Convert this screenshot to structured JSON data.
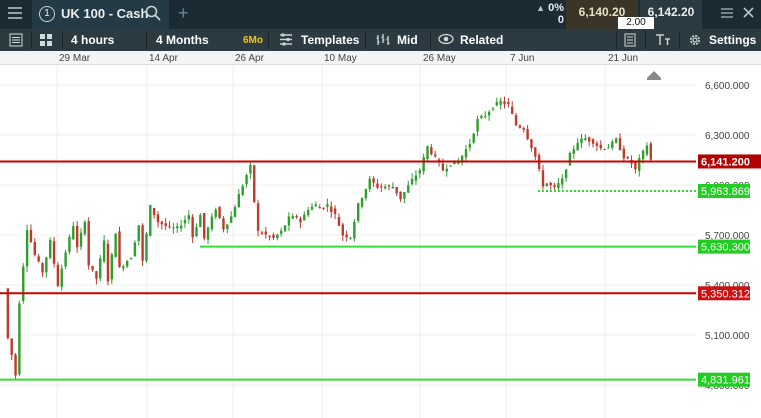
{
  "header": {
    "tab_number": "1",
    "instrument": "UK 100 - Cash",
    "change_pct": "0%",
    "change_value": "0",
    "sell_price": "6,140.20",
    "buy_price": "6,142.20",
    "spread": "2.00"
  },
  "toolbar": {
    "interval": "4 hours",
    "range": "4 Months",
    "range_preset": "6Mo",
    "templates": "Templates",
    "price_type": "Mid",
    "related": "Related",
    "settings": "Settings"
  },
  "icons": [
    "hamburger-icon",
    "search-icon",
    "plus-icon",
    "list-icon",
    "grid-icon",
    "templates-icon",
    "bar-chart-icon",
    "eye-icon",
    "doc-icon",
    "text-size-icon",
    "gear-icon",
    "detach-icon",
    "close-icon"
  ],
  "colors": {
    "up": "#2e9e2e",
    "down": "#c0392b",
    "support": "#33dd33",
    "resistance": "#cc0000"
  },
  "chart_data": {
    "type": "candlestick",
    "x_ticks": [
      "29 Mar",
      "14 Apr",
      "26 Apr",
      "10 May",
      "26 May",
      "7 Jun",
      "21 Jun"
    ],
    "y_ticks": [
      "6,600.000",
      "6,300.000",
      "6,000.000",
      "5,700.000",
      "5,400.000",
      "5,100.000",
      "4,800.000"
    ],
    "ylim": [
      4760,
      6700
    ],
    "lines": [
      {
        "label": "6,141.200",
        "value": 6141.2,
        "style": "solid",
        "color": "#cc0000"
      },
      {
        "label": "5,963.869",
        "value": 5963.869,
        "style": "dotted",
        "color": "#33dd33"
      },
      {
        "label": "5,630.300",
        "value": 5630.3,
        "style": "solid",
        "color": "#33dd33"
      },
      {
        "label": "5,350.312",
        "value": 5350.312,
        "style": "solid",
        "color": "#cc0000"
      },
      {
        "label": "4,831.961",
        "value": 4831.961,
        "style": "solid",
        "color": "#33dd33"
      }
    ],
    "series_path": [
      [
        0,
        5380
      ],
      [
        1,
        5080
      ],
      [
        2,
        4980
      ],
      [
        3,
        4860
      ],
      [
        4,
        5300
      ],
      [
        5,
        5520
      ],
      [
        6,
        5740
      ],
      [
        8,
        5580
      ],
      [
        10,
        5480
      ],
      [
        12,
        5660
      ],
      [
        14,
        5400
      ],
      [
        16,
        5600
      ],
      [
        18,
        5760
      ],
      [
        19,
        5620
      ],
      [
        21,
        5790
      ],
      [
        22,
        5520
      ],
      [
        24,
        5440
      ],
      [
        26,
        5660
      ],
      [
        27,
        5430
      ],
      [
        29,
        5720
      ],
      [
        30,
        5500
      ],
      [
        33,
        5570
      ],
      [
        35,
        5760
      ],
      [
        36,
        5540
      ],
      [
        38,
        5870
      ],
      [
        40,
        5780
      ],
      [
        43,
        5740
      ],
      [
        45,
        5740
      ],
      [
        48,
        5820
      ],
      [
        49,
        5690
      ],
      [
        51,
        5820
      ],
      [
        52,
        5680
      ],
      [
        55,
        5860
      ],
      [
        57,
        5740
      ],
      [
        59,
        5810
      ],
      [
        61,
        5940
      ],
      [
        63,
        6060
      ],
      [
        64,
        6110
      ],
      [
        65,
        5900
      ],
      [
        66,
        5720
      ],
      [
        68,
        5700
      ],
      [
        70,
        5680
      ],
      [
        72,
        5720
      ],
      [
        74,
        5800
      ],
      [
        76,
        5810
      ],
      [
        77,
        5780
      ],
      [
        79,
        5860
      ],
      [
        81,
        5880
      ],
      [
        82,
        5860
      ],
      [
        84,
        5880
      ],
      [
        86,
        5820
      ],
      [
        88,
        5700
      ],
      [
        90,
        5690
      ],
      [
        92,
        5880
      ],
      [
        95,
        6030
      ],
      [
        97,
        5990
      ],
      [
        99,
        5990
      ],
      [
        101,
        5990
      ],
      [
        103,
        5920
      ],
      [
        106,
        6030
      ],
      [
        108,
        6090
      ],
      [
        110,
        6230
      ],
      [
        112,
        6160
      ],
      [
        114,
        6090
      ],
      [
        116,
        6130
      ],
      [
        118,
        6140
      ],
      [
        121,
        6250
      ],
      [
        123,
        6390
      ],
      [
        125,
        6420
      ],
      [
        127,
        6470
      ],
      [
        129,
        6500
      ],
      [
        131,
        6480
      ],
      [
        133,
        6360
      ],
      [
        135,
        6340
      ],
      [
        137,
        6230
      ],
      [
        138,
        6170
      ],
      [
        140,
        6000
      ],
      [
        141,
        6010
      ],
      [
        143,
        5980
      ],
      [
        145,
        6030
      ],
      [
        147,
        6180
      ],
      [
        149,
        6260
      ],
      [
        151,
        6280
      ],
      [
        153,
        6260
      ],
      [
        155,
        6220
      ],
      [
        157,
        6230
      ],
      [
        159,
        6270
      ],
      [
        161,
        6170
      ],
      [
        163,
        6130
      ],
      [
        164,
        6090
      ],
      [
        165,
        6150
      ],
      [
        167,
        6240
      ],
      [
        168,
        6150
      ]
    ]
  }
}
